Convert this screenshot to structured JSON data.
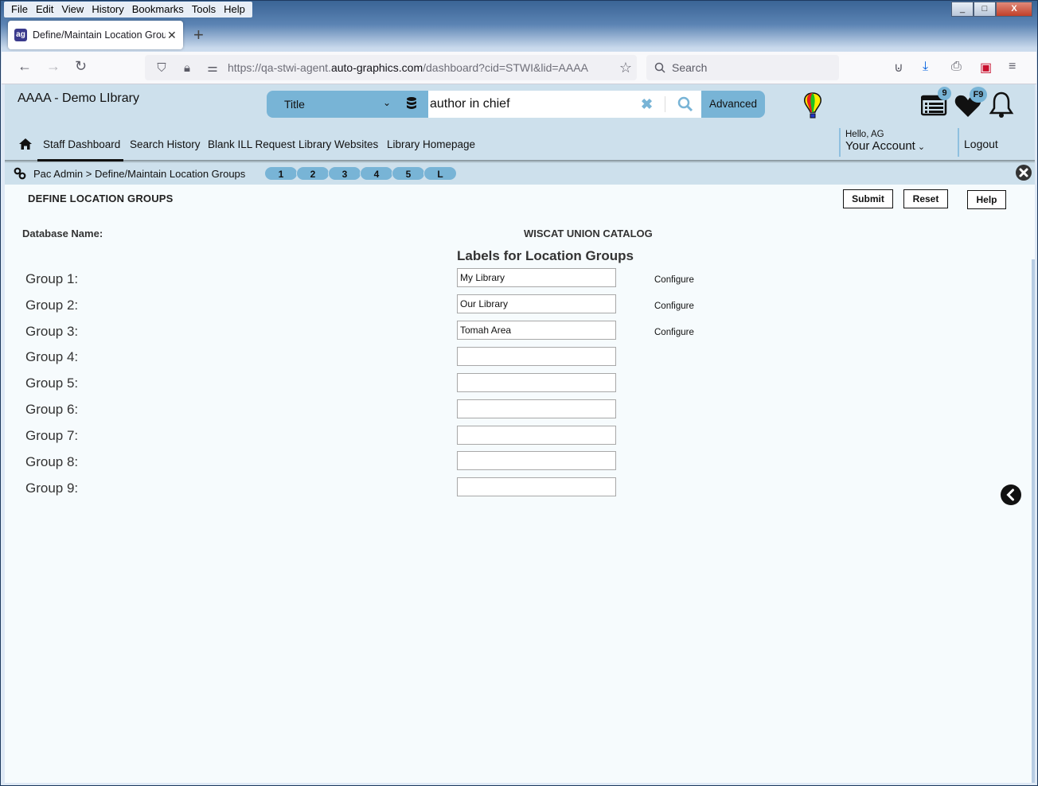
{
  "browser": {
    "menu": [
      "File",
      "Edit",
      "View",
      "History",
      "Bookmarks",
      "Tools",
      "Help"
    ],
    "tab_title": "Define/Maintain Location Groups",
    "favicon_text": "ag",
    "url_prefix": "https://qa-stwi-agent.",
    "url_domain": "auto-graphics.com",
    "url_path": "/dashboard?cid=STWI&lid=AAAA",
    "search_placeholder": "Search",
    "window_controls": {
      "minimize": "_",
      "maximize": "□",
      "close": "X"
    }
  },
  "header": {
    "library_name": "AAAA - Demo LIbrary",
    "search": {
      "type_selected": "Title",
      "query": "author in chief",
      "advanced_label": "Advanced"
    },
    "list_badge": "9",
    "favorites_badge": "F9",
    "greeting": "Hello, AG",
    "account_label": "Your Account",
    "logout_label": "Logout",
    "accent_color": "#78b4d6"
  },
  "nav": {
    "items": [
      "Staff Dashboard",
      "Search History",
      "Blank ILL Request",
      "Library Websites",
      "Library Homepage"
    ],
    "active": "Staff Dashboard"
  },
  "breadcrumb": {
    "text": "Pac Admin > Define/Maintain Location Groups",
    "pills": [
      "1",
      "2",
      "3",
      "4",
      "5",
      "L"
    ]
  },
  "main": {
    "title": "DEFINE LOCATION GROUPS",
    "buttons": {
      "submit": "Submit",
      "reset": "Reset",
      "help": "Help"
    },
    "database_label": "Database Name:",
    "database_value": "WISCAT UNION CATALOG",
    "labels_heading": "Labels for Location Groups",
    "configure_label": "Configure",
    "groups": [
      {
        "label": "Group 1:",
        "value": "My Library",
        "configurable": true
      },
      {
        "label": "Group 2:",
        "value": "Our Library",
        "configurable": true
      },
      {
        "label": "Group 3:",
        "value": "Tomah Area",
        "configurable": true
      },
      {
        "label": "Group 4:",
        "value": "",
        "configurable": false
      },
      {
        "label": "Group 5:",
        "value": "",
        "configurable": false
      },
      {
        "label": "Group 6:",
        "value": "",
        "configurable": false
      },
      {
        "label": "Group 7:",
        "value": "",
        "configurable": false
      },
      {
        "label": "Group 8:",
        "value": "",
        "configurable": false
      },
      {
        "label": "Group 9:",
        "value": "",
        "configurable": false
      }
    ]
  }
}
